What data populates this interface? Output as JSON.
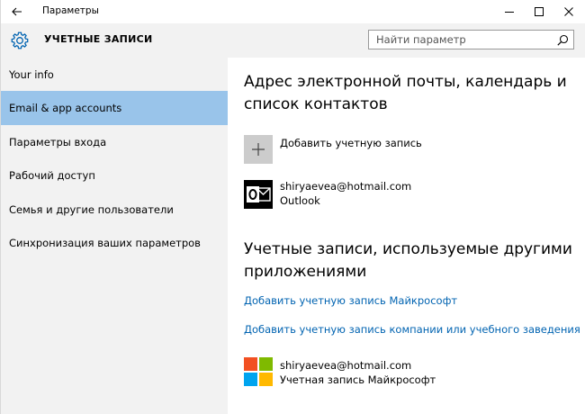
{
  "window": {
    "app_title": "Параметры",
    "controls": [
      "minimize-icon",
      "maximize-icon",
      "close-icon"
    ]
  },
  "header": {
    "section_title": "УЧЕТНЫЕ ЗАПИСИ",
    "search_placeholder": "Найти параметр"
  },
  "sidebar": {
    "items": [
      {
        "label": "Your info",
        "active": false
      },
      {
        "label": "Email & app accounts",
        "active": true
      },
      {
        "label": "Параметры входа",
        "active": false
      },
      {
        "label": "Рабочий доступ",
        "active": false
      },
      {
        "label": "Семья и другие пользователи",
        "active": false
      },
      {
        "label": "Синхронизация ваших параметров",
        "active": false
      }
    ]
  },
  "main": {
    "section1_title": "Адрес электронной почты, календарь и список контактов",
    "add_account_label": "Добавить учетную запись",
    "account1": {
      "email": "shiryaevea@hotmail.com",
      "type": "Outlook",
      "icon": "outlook-icon"
    },
    "section2_title": "Учетные записи, используемые другими приложениями",
    "link_ms": "Добавить учетную запись Майкрософт",
    "link_work": "Добавить учетную запись компании или учебного заведения",
    "account2": {
      "email": "shiryaevea@hotmail.com",
      "type": "Учетная запись Майкрософт",
      "icon": "microsoft-logo-icon"
    }
  },
  "colors": {
    "active_nav": "#99c4ea",
    "sidebar_bg": "#f2f2f2",
    "link": "#0063b1",
    "ms_red": "#f25022",
    "ms_green": "#7fba00",
    "ms_blue": "#00a4ef",
    "ms_yellow": "#ffb900"
  }
}
